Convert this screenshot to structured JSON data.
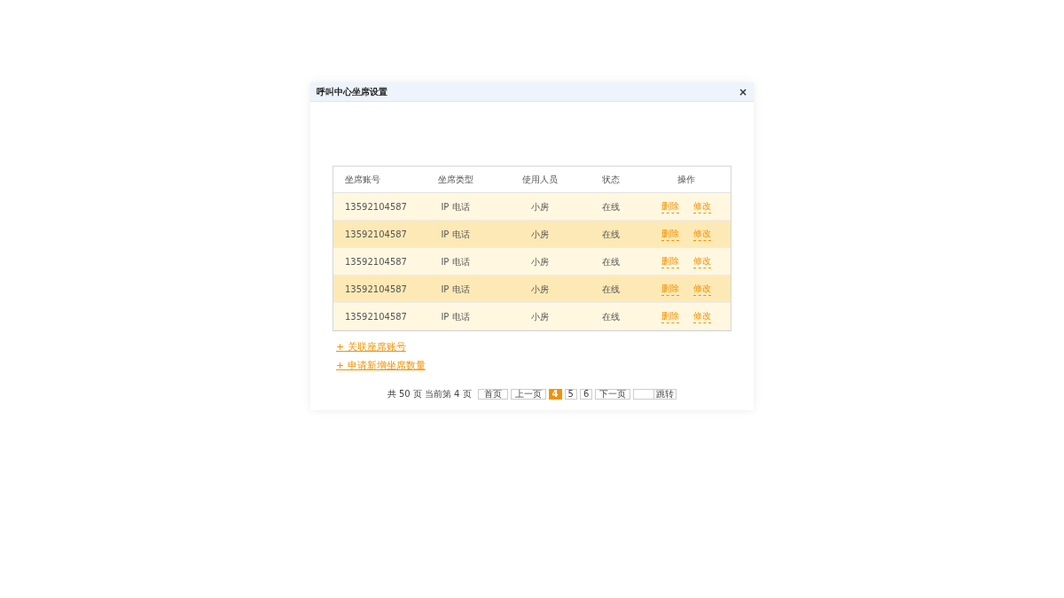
{
  "dialog": {
    "title": "呼叫中心坐席设置",
    "close": "×"
  },
  "table": {
    "columns": [
      "坐席账号",
      "坐席类型",
      "使用人员",
      "状态",
      "操作"
    ],
    "rows": [
      {
        "account": "13592104587",
        "type": "IP 电话",
        "user": "小房",
        "status": "在线",
        "actions": [
          "删除",
          "修改"
        ]
      },
      {
        "account": "13592104587",
        "type": "IP 电话",
        "user": "小房",
        "status": "在线",
        "actions": [
          "删除",
          "修改"
        ]
      },
      {
        "account": "13592104587",
        "type": "IP 电话",
        "user": "小房",
        "status": "在线",
        "actions": [
          "删除",
          "修改"
        ]
      },
      {
        "account": "13592104587",
        "type": "IP 电话",
        "user": "小房",
        "status": "在线",
        "actions": [
          "删除",
          "修改"
        ]
      },
      {
        "account": "13592104587",
        "type": "IP 电话",
        "user": "小房",
        "status": "在线",
        "actions": [
          "删除",
          "修改"
        ]
      }
    ]
  },
  "links": [
    "+ 关联座席账号",
    "+ 申请新增坐席数量"
  ],
  "pagination": {
    "total": "共 50 页",
    "current": "当前第 4 页",
    "first": "首页",
    "prev": "上一页",
    "pages": [
      {
        "label": "4",
        "selected": true
      },
      {
        "label": "5",
        "selected": false
      },
      {
        "label": "6",
        "selected": false
      }
    ],
    "next": "下一页",
    "jump": "跳转"
  }
}
